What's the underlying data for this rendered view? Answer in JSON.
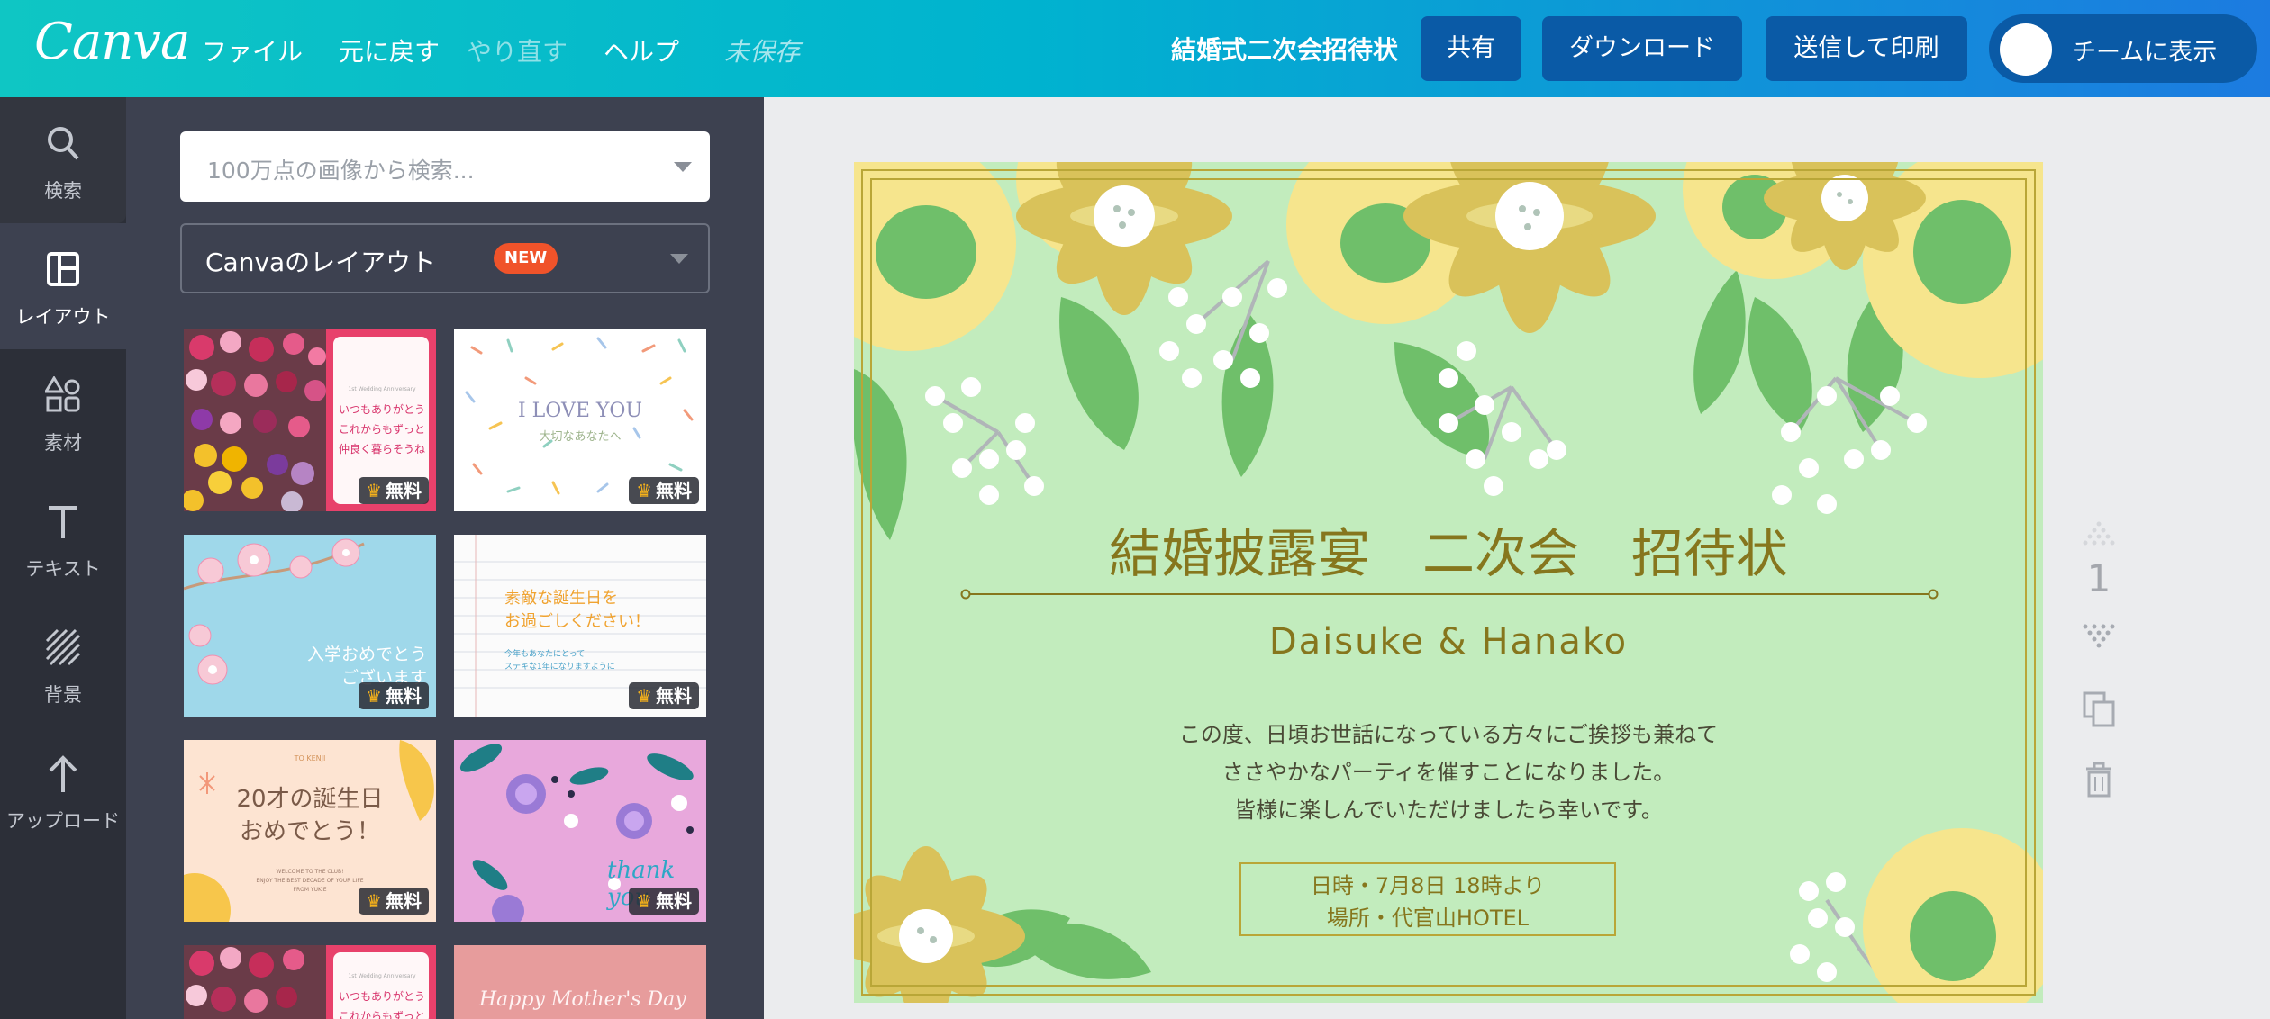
{
  "app": {
    "logo": "Canva",
    "menu": [
      "ファイル",
      "元に戻す",
      "やり直す",
      "ヘルプ"
    ],
    "save_status": "未保存",
    "doc_title": "結婚式二次会招待状",
    "buttons": {
      "share": "共有",
      "download": "ダウンロード",
      "print": "送信して印刷",
      "team": "チームに表示"
    }
  },
  "sidebar": {
    "items": [
      {
        "label": "検索",
        "icon": "search-icon"
      },
      {
        "label": "レイアウト",
        "icon": "layout-icon"
      },
      {
        "label": "素材",
        "icon": "elements-icon"
      },
      {
        "label": "テキスト",
        "icon": "text-icon"
      },
      {
        "label": "背景",
        "icon": "background-icon"
      },
      {
        "label": "アップロード",
        "icon": "upload-icon"
      }
    ],
    "active": "レイアウト"
  },
  "panel": {
    "search_placeholder": "100万点の画像から検索...",
    "category": "Canvaのレイアウト",
    "new_badge": "NEW",
    "free_label": "無料",
    "templates": [
      {
        "line1": "いつもありがとう",
        "line2": "これからもずっと",
        "line3": "仲良く暮らそうね",
        "top": "1st Wedding Anniversary"
      },
      {
        "line1": "I LOVE YOU",
        "line2": "大切なあなたへ"
      },
      {
        "line1": "入学おめでとう",
        "line2": "ございます"
      },
      {
        "line1": "素敵な誕生日を",
        "line2": "お過ごしください！",
        "line3": "今年もあなたにとって",
        "line4": "ステキな1年になりますように"
      },
      {
        "line1": "20才の誕生日",
        "line2": "おめでとう！",
        "top": "TO KENJI",
        "line3": "WELCOME TO THE CLUB!",
        "line4": "ENJOY THE BEST DECADE OF YOUR LIFE",
        "line5": "FROM YUKIE"
      },
      {
        "line1": "thank you"
      },
      {
        "line1": "いつもありがとう",
        "line2": "これからもずっと",
        "top": "1st Wedding Anniversary"
      },
      {
        "line1": "Happy Mother's Day"
      }
    ]
  },
  "card": {
    "title": "結婚披露宴　二次会　招待状",
    "names": "Daisuke & Hanako",
    "body": [
      "この度、日頃お世話になっている方々にご挨拶も兼ねて",
      "ささやかなパーティを催すことになりました。",
      "皆様に楽しんでいただけましたら幸いです。"
    ],
    "info": [
      "日時・7月8日 18時より",
      "場所・代官山HOTEL"
    ]
  },
  "page_number": "1",
  "colors": {
    "card_background": "#c2ecbd",
    "gold": "#86761d",
    "flower_yellow": "#f6e58d",
    "flower_gold": "#d9c25a",
    "leaf_green": "#6fbf6a",
    "accent_new": "#f0532a"
  }
}
